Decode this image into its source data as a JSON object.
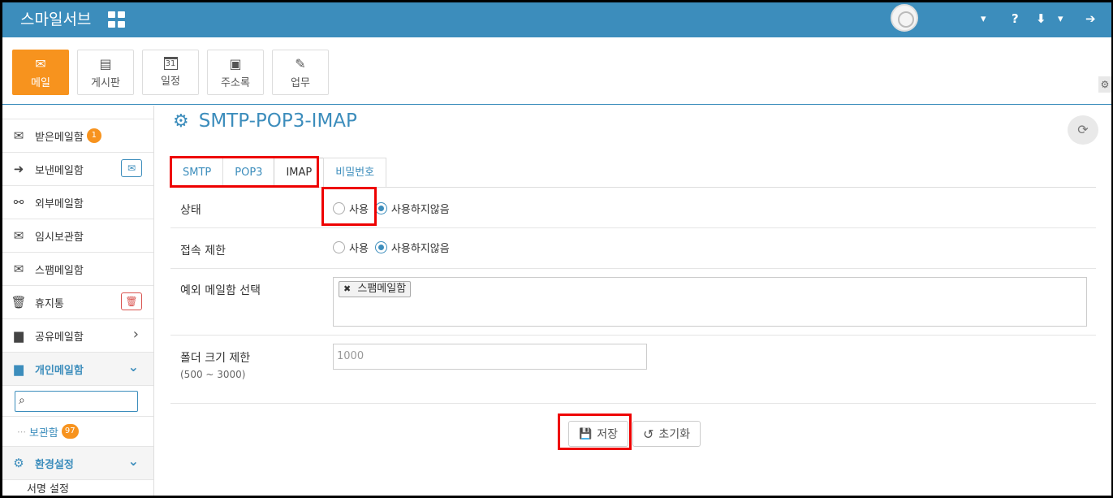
{
  "topbar": {
    "brand": "스마일서브",
    "icons": [
      "apps-grid-icon",
      "avatar",
      "caret-down-icon",
      "help-icon",
      "download-icon",
      "logout-icon"
    ],
    "help_glyph": "?",
    "download_glyph": "⬇",
    "caret_glyph": "▾",
    "logout_glyph": "➔"
  },
  "apps": [
    {
      "label": "메일",
      "icon": "mail-icon",
      "glyph": "✉",
      "active": true
    },
    {
      "label": "게시판",
      "icon": "board-icon",
      "glyph": "▤",
      "active": false
    },
    {
      "label": "일정",
      "icon": "calendar-icon",
      "glyph": "31",
      "active": false
    },
    {
      "label": "주소록",
      "icon": "contacts-icon",
      "glyph": "▣",
      "active": false
    },
    {
      "label": "업무",
      "icon": "task-icon",
      "glyph": "✎",
      "active": false
    }
  ],
  "sidebar": {
    "items": [
      {
        "label": "받은메일함",
        "icon": "inbox-icon",
        "glyph": "✉",
        "badge": "1"
      },
      {
        "label": "보낸메일함",
        "icon": "sent-icon",
        "glyph": "➜",
        "action_icon": "mail-check-icon",
        "action_glyph": "✉"
      },
      {
        "label": "외부메일함",
        "icon": "external-link-icon",
        "glyph": "⚯"
      },
      {
        "label": "임시보관함",
        "icon": "draft-icon",
        "glyph": "✉"
      },
      {
        "label": "스팸메일함",
        "icon": "spam-icon",
        "glyph": "✉"
      },
      {
        "label": "휴지통",
        "icon": "trash-icon",
        "glyph": "🗑",
        "action_icon": "empty-trash-icon",
        "action_glyph": "🗑"
      },
      {
        "label": "공유메일함",
        "icon": "shared-folder-icon",
        "glyph": "▆",
        "chevron": "›"
      }
    ],
    "personal": {
      "label": "개인메일함",
      "icon": "folder-icon",
      "glyph": "▆",
      "chevron": "⌄"
    },
    "search_glyph": "⌕",
    "sub_items": [
      {
        "label": "보관함",
        "badge": "97",
        "tree": "⋯"
      }
    ],
    "settings": {
      "label": "환경설정",
      "icon": "gear-icon",
      "glyph": "⚙",
      "chevron": "⌄"
    },
    "settings_first": "서명 설정"
  },
  "main": {
    "title": "SMTP-POP3-IMAP",
    "title_glyph": "⚙",
    "refresh_glyph": "⟳",
    "tabs": [
      {
        "label": "SMTP",
        "active": false
      },
      {
        "label": "POP3",
        "active": false
      },
      {
        "label": "IMAP",
        "active": true
      },
      {
        "label": "비밀번호",
        "active": false
      }
    ],
    "status": {
      "label": "상태",
      "options": [
        "사용",
        "사용하지않음"
      ],
      "selected": "사용하지않음"
    },
    "access": {
      "label": "접속 제한",
      "options": [
        "사용",
        "사용하지않음"
      ],
      "selected": "사용하지않음"
    },
    "except": {
      "label": "예외 메일함 선택",
      "tags": [
        "스팸메일함"
      ],
      "remove_glyph": "✖"
    },
    "folder_limit": {
      "label": "폴더 크기 제한",
      "hint": "(500 ~ 3000)",
      "placeholder": "1000"
    },
    "buttons": {
      "save": "저장",
      "save_glyph": "💾",
      "reset": "초기화",
      "reset_glyph": "↺"
    }
  }
}
